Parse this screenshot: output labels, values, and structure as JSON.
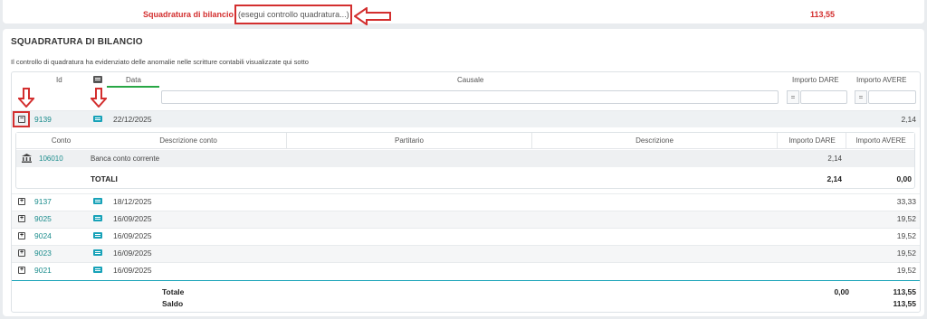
{
  "top": {
    "label": "Squadratura di bilancio",
    "link": "(esegui controllo quadratura...)",
    "amount": "113,55"
  },
  "section": {
    "title": "SQUADRATURA DI BILANCIO",
    "description": "Il controllo di quadratura ha evidenziato delle anomalie nelle scritture contabili visualizzate qui sotto"
  },
  "columns": {
    "id": "Id",
    "data": "Data",
    "causale": "Causale",
    "dare": "Importo DARE",
    "avere": "Importo AVERE",
    "eq": "="
  },
  "expanded_row": {
    "id": "9139",
    "date": "22/12/2025",
    "avere": "2,14"
  },
  "sub": {
    "columns": {
      "conto": "Conto",
      "descr_conto": "Descrizione conto",
      "partitario": "Partitario",
      "descrizione": "Descrizione",
      "dare": "Importo DARE",
      "avere": "Importo AVERE"
    },
    "row": {
      "conto": "106010",
      "descr": "Banca conto corrente",
      "dare": "2,14"
    },
    "totals": {
      "label": "TOTALI",
      "dare": "2,14",
      "avere": "0,00"
    }
  },
  "rows": [
    {
      "id": "9137",
      "date": "18/12/2025",
      "avere": "33,33"
    },
    {
      "id": "9025",
      "date": "16/09/2025",
      "avere": "19,52"
    },
    {
      "id": "9024",
      "date": "16/09/2025",
      "avere": "19,52"
    },
    {
      "id": "9023",
      "date": "16/09/2025",
      "avere": "19,52"
    },
    {
      "id": "9021",
      "date": "16/09/2025",
      "avere": "19,52"
    }
  ],
  "footer": {
    "totale_label": "Totale",
    "saldo_label": "Saldo",
    "totale_dare": "0,00",
    "totale_avere": "113,55",
    "saldo_avere": "113,55"
  },
  "colors": {
    "accent": "#17a2b8",
    "highlight": "#d32f2f",
    "link": "#1a8c8c"
  }
}
